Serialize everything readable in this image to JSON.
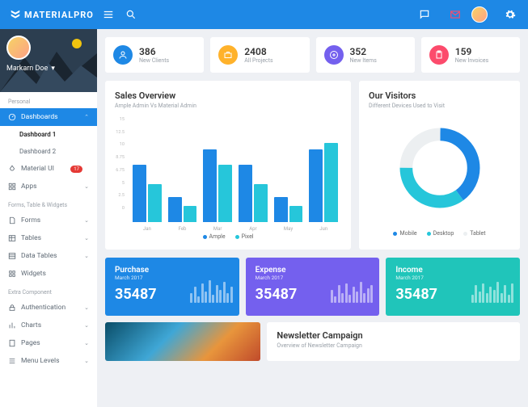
{
  "brand": "MATERIALPRO",
  "user": {
    "name": "Markarn Doe"
  },
  "sidebar": {
    "sections": [
      {
        "title": "Personal",
        "items": [
          {
            "label": "Dashboards",
            "icon": "gauge",
            "active": true,
            "children": [
              {
                "label": "Dashboard 1",
                "current": true
              },
              {
                "label": "Dashboard 2"
              }
            ]
          },
          {
            "label": "Material UI",
            "icon": "drop",
            "badge": "17"
          },
          {
            "label": "Apps",
            "icon": "grid"
          }
        ]
      },
      {
        "title": "Forms, Table & Widgets",
        "items": [
          {
            "label": "Forms",
            "icon": "file"
          },
          {
            "label": "Tables",
            "icon": "table"
          },
          {
            "label": "Data Tables",
            "icon": "dtable"
          },
          {
            "label": "Widgets",
            "icon": "widget"
          }
        ]
      },
      {
        "title": "Extra Component",
        "items": [
          {
            "label": "Authentication",
            "icon": "lock"
          },
          {
            "label": "Charts",
            "icon": "bar"
          },
          {
            "label": "Pages",
            "icon": "page"
          },
          {
            "label": "Menu Levels",
            "icon": "menu"
          }
        ]
      }
    ]
  },
  "stats": [
    {
      "value": "386",
      "label": "New Clients",
      "color": "blue",
      "icon": "user"
    },
    {
      "value": "2408",
      "label": "All Projects",
      "color": "yellow",
      "icon": "briefcase"
    },
    {
      "value": "352",
      "label": "New Items",
      "color": "purple",
      "icon": "plus"
    },
    {
      "value": "159",
      "label": "New Invoices",
      "color": "red",
      "icon": "clipboard"
    }
  ],
  "sales": {
    "title": "Sales Overview",
    "subtitle": "Ample Admin Vs Material Admin",
    "legend": [
      "Ample",
      "Pixel"
    ]
  },
  "visitors": {
    "title": "Our Visitors",
    "subtitle": "Different Devices Used to Visit",
    "legend": [
      "Mobile",
      "Desktop",
      "Tablet"
    ]
  },
  "chart_data": {
    "sales": {
      "type": "bar",
      "categories": [
        "Jan",
        "Feb",
        "Mar",
        "Apr",
        "May",
        "Jun"
      ],
      "series": [
        {
          "name": "Ample",
          "values": [
            9.0,
            4.0,
            11.5,
            9.0,
            4.0,
            11.5
          ]
        },
        {
          "name": "Pixel",
          "values": [
            6.0,
            2.5,
            9.0,
            6.0,
            2.5,
            12.5
          ]
        }
      ],
      "ylim": [
        0,
        15
      ],
      "yticks": [
        0,
        2.5,
        5,
        6.75,
        8.75,
        10,
        12.5,
        15
      ],
      "xlabel": "",
      "ylabel": ""
    },
    "visitors": {
      "type": "pie",
      "slices": [
        {
          "name": "Mobile",
          "value": 40,
          "color": "#1e88e5"
        },
        {
          "name": "Desktop",
          "value": 35,
          "color": "#26c6da"
        },
        {
          "name": "Tablet",
          "value": 25,
          "color": "#eceff1"
        }
      ]
    }
  },
  "metrics": [
    {
      "title": "Purchase",
      "sub": "March 2017",
      "value": "35487",
      "color": "blue",
      "spark": [
        30,
        50,
        20,
        60,
        35,
        70,
        25,
        55,
        40,
        65,
        30,
        50
      ]
    },
    {
      "title": "Expense",
      "sub": "March 2017",
      "value": "35487",
      "color": "purple",
      "spark": [
        40,
        20,
        55,
        30,
        60,
        25,
        50,
        35,
        65,
        30,
        45,
        55
      ]
    },
    {
      "title": "Income",
      "sub": "March 2017",
      "value": "35487",
      "color": "teal",
      "spark": [
        25,
        55,
        35,
        60,
        30,
        50,
        40,
        65,
        30,
        55,
        25,
        60
      ]
    }
  ],
  "newsletter": {
    "title": "Newsletter Campaign",
    "subtitle": "Overview of Newsletter Campaign"
  }
}
